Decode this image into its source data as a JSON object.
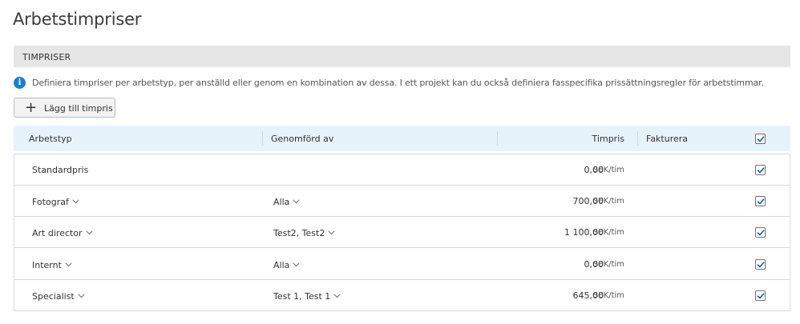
{
  "page": {
    "title": "Arbetstimpriser"
  },
  "section": {
    "title": "TIMPRISER"
  },
  "info": {
    "icon": "info-icon",
    "text": "Definiera timpriser per arbetstyp, per anställd eller genom en kombination av dessa. I ett projekt kan du också definiera fasspecifika prissättningsregler för arbetstimmar."
  },
  "toolbar": {
    "add_label": "Lägg till timpris",
    "add_icon": "plus-icon"
  },
  "table": {
    "headers": {
      "worktype": "Arbetstyp",
      "performed_by": "Genomförd av",
      "price": "Timpris",
      "invoice": "Fakturera"
    },
    "header_invoice_checked": true,
    "rows": [
      {
        "worktype": "Standardpris",
        "worktype_dropdown": false,
        "performed_by": "",
        "performed_dropdown": false,
        "price": "0,00",
        "unit": "SEK/tim",
        "invoice": true
      },
      {
        "worktype": "Fotograf",
        "worktype_dropdown": true,
        "performed_by": "Alla",
        "performed_dropdown": true,
        "price": "700,00",
        "unit": "SEK/tim",
        "invoice": true
      },
      {
        "worktype": "Art director",
        "worktype_dropdown": true,
        "performed_by": "Test2, Test2",
        "performed_dropdown": true,
        "price": "1 100,00",
        "unit": "SEK/tim",
        "invoice": true
      },
      {
        "worktype": "Internt",
        "worktype_dropdown": true,
        "performed_by": "Alla",
        "performed_dropdown": true,
        "price": "0,00",
        "unit": "SEK/tim",
        "invoice": true
      },
      {
        "worktype": "Specialist",
        "worktype_dropdown": true,
        "performed_by": "Test 1, Test 1",
        "performed_dropdown": true,
        "price": "645,00",
        "unit": "SEK/tim",
        "invoice": true
      }
    ]
  },
  "colors": {
    "accent": "#1a7fd4",
    "header_bg": "#e7f3fb",
    "section_bg": "#e6e6e6"
  }
}
